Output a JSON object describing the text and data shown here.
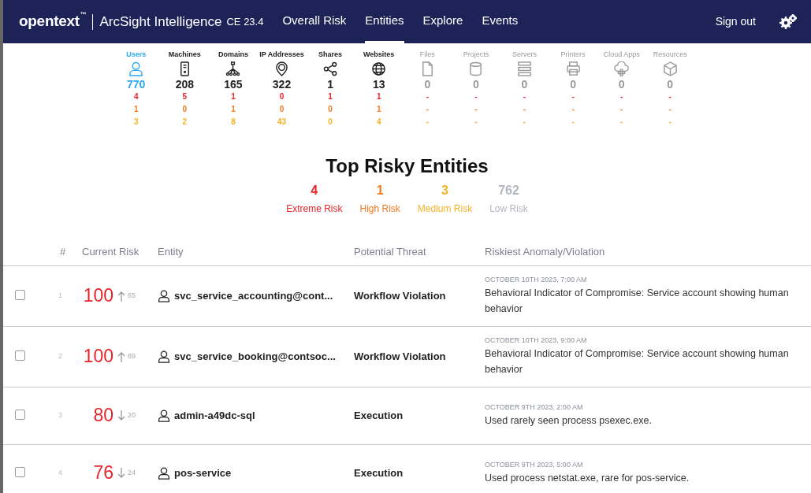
{
  "navbar": {
    "brand": "opentext",
    "brand_mark": "™",
    "product": "ArcSight Intelligence",
    "version": "CE 23.4",
    "items": [
      {
        "label": "Overall Risk",
        "selected": false
      },
      {
        "label": "Entities",
        "selected": true
      },
      {
        "label": "Explore",
        "selected": false
      },
      {
        "label": "Events",
        "selected": false
      }
    ],
    "sign_out": "Sign out"
  },
  "categories": [
    {
      "label": "Users",
      "selected": true,
      "disabled": false,
      "total": "770",
      "extreme": "4",
      "high": "1",
      "medium": "3"
    },
    {
      "label": "Machines",
      "selected": false,
      "disabled": false,
      "total": "208",
      "extreme": "5",
      "high": "0",
      "medium": "2"
    },
    {
      "label": "Domains",
      "selected": false,
      "disabled": false,
      "total": "165",
      "extreme": "1",
      "high": "1",
      "medium": "8"
    },
    {
      "label": "IP Addresses",
      "selected": false,
      "disabled": false,
      "total": "322",
      "extreme": "0",
      "high": "0",
      "medium": "43"
    },
    {
      "label": "Shares",
      "selected": false,
      "disabled": false,
      "total": "1",
      "extreme": "1",
      "high": "0",
      "medium": "0"
    },
    {
      "label": "Websites",
      "selected": false,
      "disabled": false,
      "total": "13",
      "extreme": "1",
      "high": "1",
      "medium": "4"
    },
    {
      "label": "Files",
      "selected": false,
      "disabled": true,
      "total": "0",
      "extreme": "-",
      "high": "-",
      "medium": "-"
    },
    {
      "label": "Projects",
      "selected": false,
      "disabled": true,
      "total": "0",
      "extreme": "-",
      "high": "-",
      "medium": "-"
    },
    {
      "label": "Servers",
      "selected": false,
      "disabled": true,
      "total": "0",
      "extreme": "-",
      "high": "-",
      "medium": "-"
    },
    {
      "label": "Printers",
      "selected": false,
      "disabled": true,
      "total": "0",
      "extreme": "-",
      "high": "-",
      "medium": "-"
    },
    {
      "label": "Cloud Apps",
      "selected": false,
      "disabled": true,
      "total": "0",
      "extreme": "-",
      "high": "-",
      "medium": "-"
    },
    {
      "label": "Resources",
      "selected": false,
      "disabled": true,
      "total": "0",
      "extreme": "-",
      "high": "-",
      "medium": "-"
    }
  ],
  "summary": {
    "title": "Top Risky Entities",
    "levels": [
      {
        "kind": "extreme",
        "count": "4",
        "label": "Extreme Risk"
      },
      {
        "kind": "high",
        "count": "1",
        "label": "High Risk"
      },
      {
        "kind": "medium",
        "count": "3",
        "label": "Medium Risk"
      },
      {
        "kind": "low",
        "count": "762",
        "label": "Low Risk"
      }
    ]
  },
  "table": {
    "columns": [
      "#",
      "Current Risk",
      "Entity",
      "Potential Threat",
      "Riskiest Anomaly/Violation"
    ],
    "rows": [
      {
        "checked": false,
        "index": "1",
        "risk": "100",
        "rising": true,
        "delta": "65",
        "entity": "svc_service_accounting@cont...",
        "threat": "Workflow Violation",
        "date": "OCTOBER 10TH 2023, 7:00 AM",
        "anomaly": "Behavioral Indicator of Compromise: Service account showing human behavior"
      },
      {
        "checked": false,
        "index": "2",
        "risk": "100",
        "rising": true,
        "delta": "89",
        "entity": "svc_service_booking@contsoc...",
        "threat": "Workflow Violation",
        "date": "OCTOBER 10TH 2023, 9:00 AM",
        "anomaly": "Behavioral Indicator of Compromise: Service account showing human behavior"
      },
      {
        "checked": false,
        "index": "3",
        "risk": "80",
        "rising": false,
        "delta": "20",
        "entity": "admin-a49dc-sql",
        "threat": "Execution",
        "date": "OCTOBER 9TH 2023, 2:00 AM",
        "anomaly": "Used rarely seen process psexec.exe."
      },
      {
        "checked": false,
        "index": "4",
        "risk": "76",
        "rising": false,
        "delta": "24",
        "entity": "pos-service",
        "threat": "Execution",
        "date": "OCTOBER 9TH 2023, 5:00 AM",
        "anomaly": "Used process netstat.exe, rare for pos-service."
      }
    ]
  }
}
